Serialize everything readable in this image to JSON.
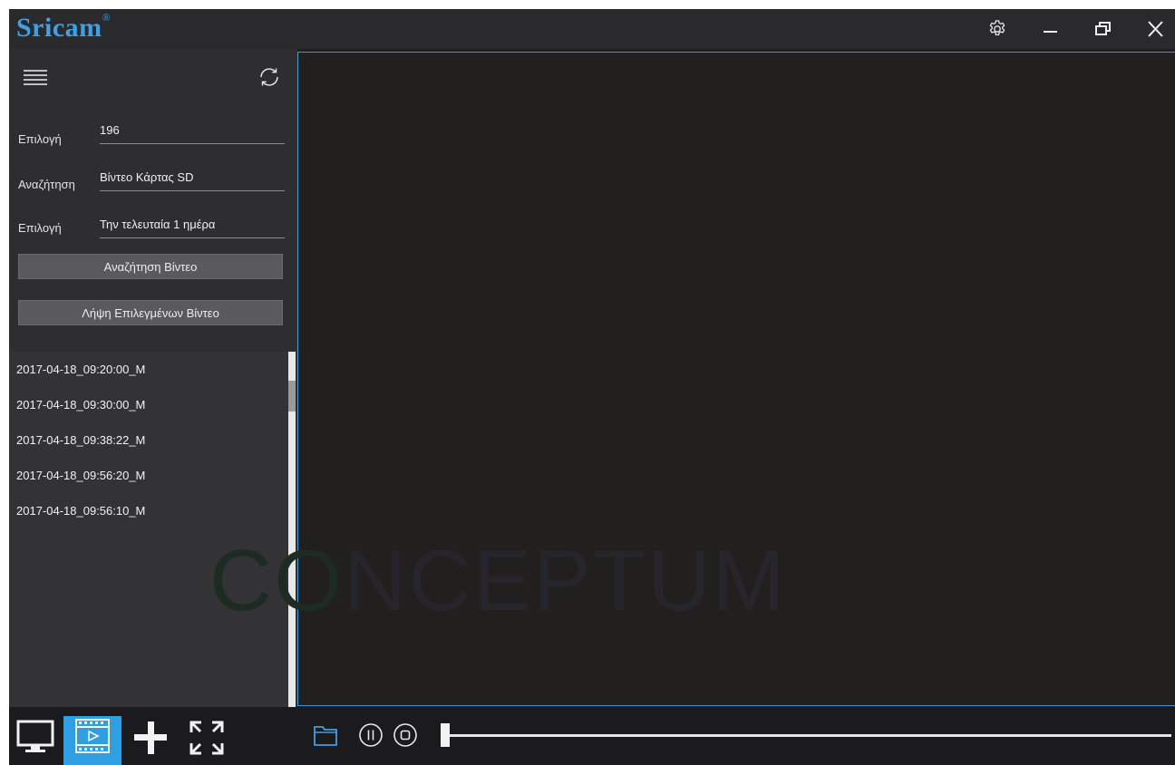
{
  "app": {
    "logo_text": "Sricam",
    "logo_mark": "®",
    "accent_color": "#3ea0e6"
  },
  "window_controls": [
    {
      "name": "settings-icon"
    },
    {
      "name": "minimize-icon"
    },
    {
      "name": "restore-icon"
    },
    {
      "name": "close-icon"
    }
  ],
  "sidebar": {
    "fields": [
      {
        "label": "Επιλογή",
        "value": "196"
      },
      {
        "label": "Αναζήτηση",
        "value": "Βίντεο Κάρτας SD"
      },
      {
        "label": "Επιλογή",
        "value": "Την τελευταία 1 ημέρα"
      }
    ],
    "search_button": "Αναζήτηση Βίντεο",
    "download_button": "Λήψη Επιλεγμένων Βίντεο",
    "videos": [
      "2017-04-18_09:20:00_M",
      "2017-04-18_09:30:00_M",
      "2017-04-18_09:38:22_M",
      "2017-04-18_09:56:20_M",
      "2017-04-18_09:56:10_M"
    ]
  },
  "video": {
    "watermark_prefix": "CO",
    "watermark_rest": "NCEPTUM"
  },
  "bottom_toolbar": {
    "tools": [
      "monitor-icon",
      "playback-icon",
      "add-icon",
      "fullscreen-icon"
    ],
    "active_tool": "playback-icon",
    "player_controls": [
      "folder-icon",
      "pause-icon",
      "stop-icon"
    ],
    "progress": 0
  }
}
